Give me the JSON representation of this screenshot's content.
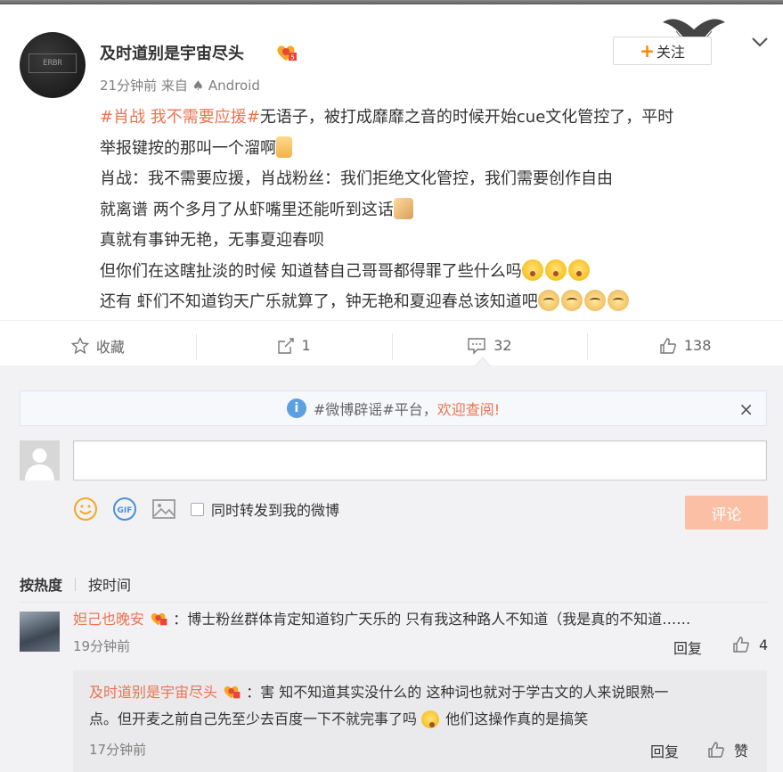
{
  "post": {
    "username": "及时道别是宇宙尽头",
    "time": "21分钟前",
    "source_prefix": "来自",
    "source": "Android",
    "follow_label": "关注",
    "avatar_text": "ERBR",
    "content": {
      "line1_topic": "#肖战 我不需要应援#",
      "line1_text": "无语子，被打成靡靡之音的时候开始cue文化管控了，平时",
      "line2": "举报键按的那叫一个溜啊",
      "line3": "肖战：我不需要应援，肖战粉丝：我们拒绝文化管控，我们需要创作自由",
      "line4": "就离谱 两个多月了从虾嘴里还能听到这话",
      "line5": "真就有事钟无艳，无事夏迎春呗",
      "line6": "但你们在这瞎扯淡的时候 知道替自己哥哥都得罪了些什么吗",
      "line7": "还有 虾们不知道钧天广乐就算了，钟无艳和夏迎春总该知道吧"
    },
    "actions": {
      "favorite": "收藏",
      "repost": "1",
      "comment": "32",
      "like": "138"
    }
  },
  "comment_section": {
    "notice_topic": "#微博辟谣#平台，",
    "notice_link": "欢迎查阅!",
    "checkbox_label": "同时转发到我的微博",
    "submit_label": "评论",
    "sort_hot": "按热度",
    "sort_time": "按时间"
  },
  "comments": [
    {
      "name": "妲己也晚安",
      "text": "：博士粉丝群体肯定知道钧广天乐的 只有我这种路人不知道（我是真的不知道……",
      "time": "19分钟前",
      "reply": "回复",
      "likes": "4"
    }
  ],
  "sub_comment": {
    "name": "及时道别是宇宙尽头",
    "text1": "：害 知不知道其实没什么的 这种词也就对于学古文的人来说眼熟一",
    "text2a": "点。但开麦之前自己先至少去百度一下不就完事了吗",
    "text2b": "他们这操作真的是搞笑",
    "time": "17分钟前",
    "reply": "回复",
    "like_label": "赞"
  },
  "colors": {
    "orange": "#ff8200",
    "topic": "#eb7350",
    "submit": "#fbbfa5"
  }
}
